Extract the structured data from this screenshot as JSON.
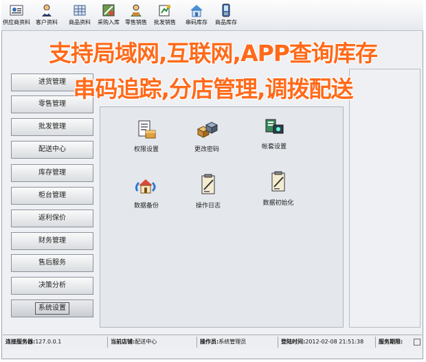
{
  "toolbar": {
    "items": [
      {
        "label": "供应商资料",
        "icon": "supplier-card-icon"
      },
      {
        "label": "客户资料",
        "icon": "customer-person-icon"
      },
      {
        "label": "商品资料",
        "icon": "goods-grid-icon"
      },
      {
        "label": "采购入库",
        "icon": "purchase-in-icon"
      },
      {
        "label": "零售销售",
        "icon": "retail-sale-icon"
      },
      {
        "label": "批发销售",
        "icon": "wholesale-icon"
      },
      {
        "label": "串码库存",
        "icon": "serial-stock-house-icon"
      },
      {
        "label": "商品库存",
        "icon": "goods-stock-phone-icon"
      }
    ]
  },
  "banner": {
    "line1": "支持局域网,互联网,APP查询库存",
    "line2": "串码追踪,分店管理,调拨配送"
  },
  "nav": {
    "items": [
      {
        "label": "进货管理"
      },
      {
        "label": "零售管理"
      },
      {
        "label": "批发管理"
      },
      {
        "label": "配送中心"
      },
      {
        "label": "库存管理"
      },
      {
        "label": "柜台管理"
      },
      {
        "label": "返利保价"
      },
      {
        "label": "财务管理"
      },
      {
        "label": "售后服务"
      },
      {
        "label": "决策分析"
      },
      {
        "label": "系统设置"
      }
    ],
    "active": "系统设置"
  },
  "functions": [
    {
      "label": "权限设置",
      "icon": "permission-document-icon"
    },
    {
      "label": "更改密码",
      "icon": "change-password-cubes-icon"
    },
    {
      "label": "帐套设置",
      "icon": "account-set-icon"
    },
    {
      "label": "数据备份",
      "icon": "data-backup-house-icon"
    },
    {
      "label": "操作日志",
      "icon": "operation-log-note-icon"
    },
    {
      "label": "数据初始化",
      "icon": "data-init-note-icon"
    }
  ],
  "status": {
    "server_label": "连接服务器:",
    "server_value": "127.0.0.1",
    "store_label": "当前店铺:",
    "store_value": "配送中心",
    "operator_label": "操作员:",
    "operator_value": "系统管理员",
    "login_label": "登陆时间:",
    "login_value": "2012-02-08 21:51:38",
    "expiry_label": "服务期限:",
    "expiry_value": ""
  },
  "colors": {
    "banner": "#ff6a1a",
    "panel": "#e4e7ec"
  }
}
